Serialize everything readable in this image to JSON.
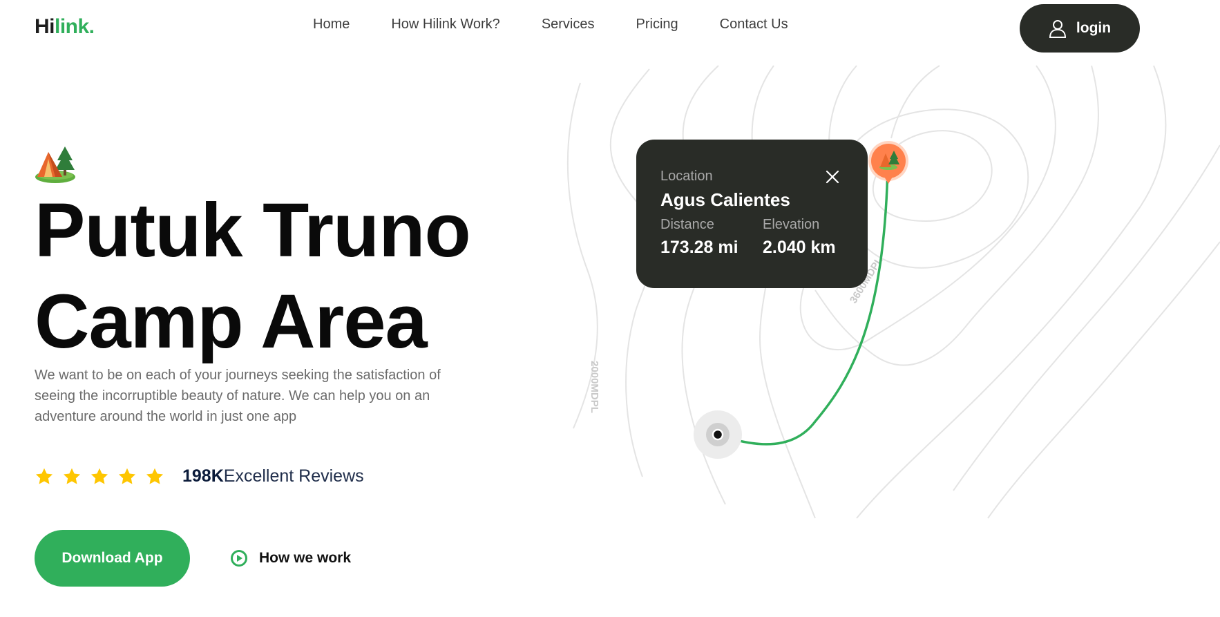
{
  "header": {
    "logo_part1": "Hi",
    "logo_part2": "link.",
    "nav": [
      "Home",
      "How Hilink Work?",
      "Services",
      "Pricing",
      "Contact Us"
    ],
    "login_label": "login"
  },
  "hero": {
    "title_line1": "Putuk Truno",
    "title_line2": "Camp Area",
    "description": "We want to be on each of your journeys seeking the satisfaction of seeing the incorruptible beauty of nature. We can help you on an adventure around the world in just one app",
    "rating_stars": 5,
    "review_count": "198K",
    "review_label": "Excellent Reviews",
    "download_label": "Download App",
    "how_label": "How we work"
  },
  "map": {
    "contour_labels": [
      "2000MDPL",
      "3600MDPL"
    ],
    "card": {
      "location_label": "Location",
      "location_name": "Agus Calientes",
      "distance_label": "Distance",
      "distance_value": "173.28 mi",
      "elevation_label": "Elevation",
      "elevation_value": "2.040 km"
    }
  },
  "colors": {
    "brand_green": "#30af5b",
    "dark": "#292c27",
    "star": "#fec601",
    "pin_orange": "#ff814c"
  },
  "icons": [
    "user-icon",
    "tent-icon",
    "star-icon",
    "play-icon",
    "close-icon",
    "map-pin-icon"
  ]
}
